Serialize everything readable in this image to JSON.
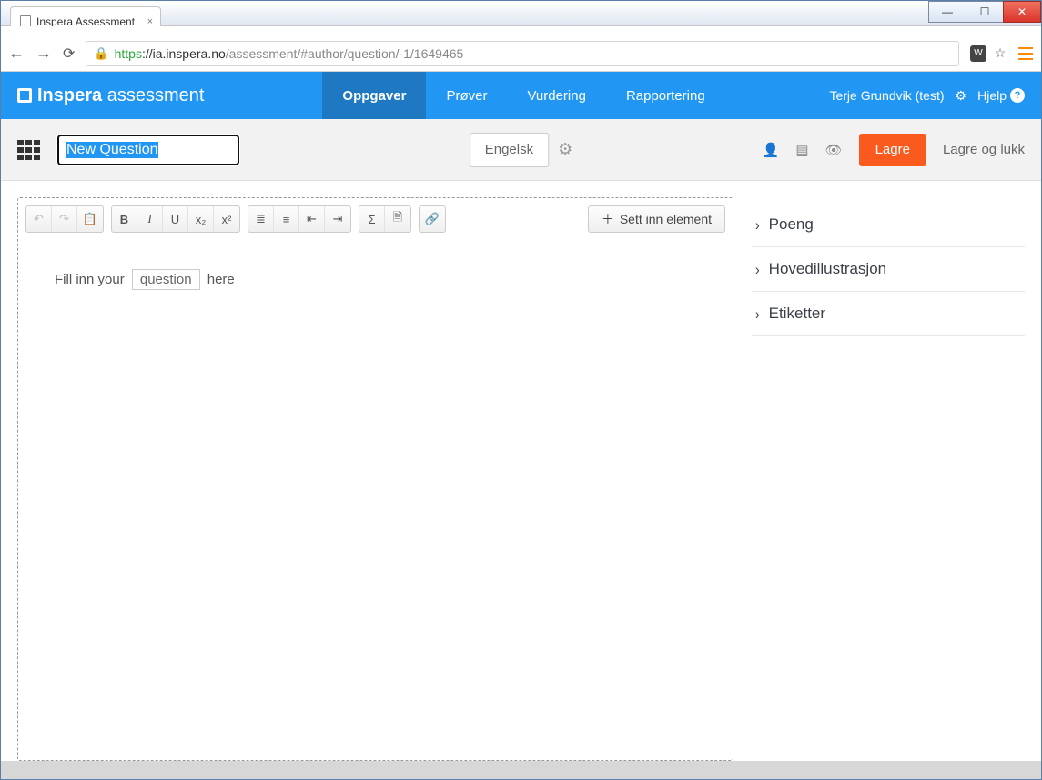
{
  "browser": {
    "tab_title": "Inspera Assessment",
    "url_full": "https://ia.inspera.no/assessment/#author/question/-1/1649465",
    "url_proto": "https",
    "url_host": "://ia.inspera.no",
    "url_path": "/assessment/#author/question/-1/1649465"
  },
  "appnav": {
    "brand_bold": "Inspera",
    "brand_light": " assessment",
    "items": [
      "Oppgaver",
      "Prøver",
      "Vurdering",
      "Rapportering"
    ],
    "active_index": 0,
    "user": "Terje Grundvik (test)",
    "help": "Hjelp"
  },
  "subbar": {
    "title_value": "New Question",
    "language_button": "Engelsk",
    "save": "Lagre",
    "save_and_close": "Lagre og lukk"
  },
  "editor": {
    "insert_element": "Sett inn element",
    "placeholder_pre": "Fill inn your ",
    "placeholder_token": "question",
    "placeholder_post": " here"
  },
  "sidebar": {
    "items": [
      "Poeng",
      "Hovedillustrasjon",
      "Etiketter"
    ]
  },
  "icons": {
    "undo": "↶",
    "redo": "↷",
    "paste": "📋",
    "bold": "B",
    "italic": "I",
    "underline": "U",
    "sub": "x₂",
    "sup": "x²",
    "ol": "≣",
    "ul": "≡",
    "outdent": "⇤",
    "indent": "⇥",
    "sigma": "Σ",
    "page": "🗎",
    "link": "🔗",
    "plus": "＋"
  }
}
